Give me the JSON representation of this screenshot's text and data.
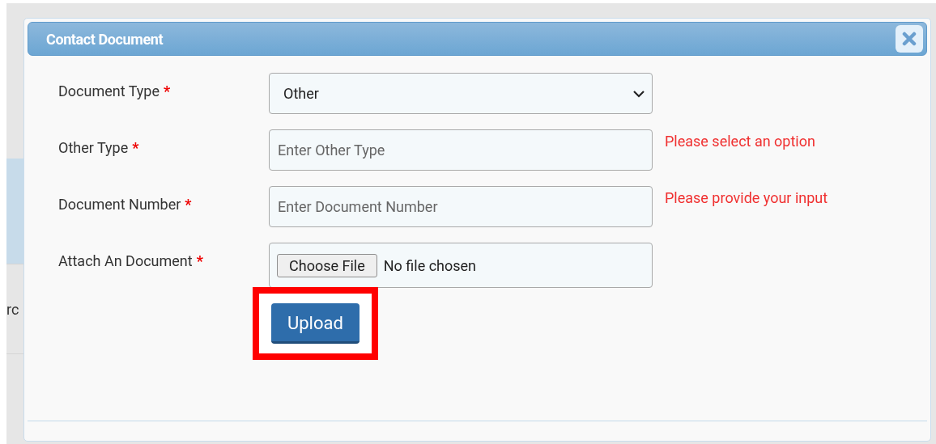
{
  "background": {
    "fragment_text": "rc"
  },
  "dialog": {
    "title": "Contact Document",
    "fields": [
      {
        "kind": "select",
        "label": "Document Type",
        "required_mark": "*",
        "value": "Other"
      },
      {
        "kind": "text",
        "label": "Other Type",
        "required_mark": "*",
        "placeholder": "Enter Other Type",
        "error": "Please select an option"
      },
      {
        "kind": "text",
        "label": "Document Number",
        "required_mark": "*",
        "placeholder": "Enter Document Number",
        "error": "Please provide your input"
      },
      {
        "kind": "file",
        "label": "Attach An Document",
        "required_mark": "*",
        "button": "Choose File",
        "status": "No file chosen"
      }
    ],
    "upload_button": {
      "label": "Upload",
      "highlighted": true
    }
  }
}
